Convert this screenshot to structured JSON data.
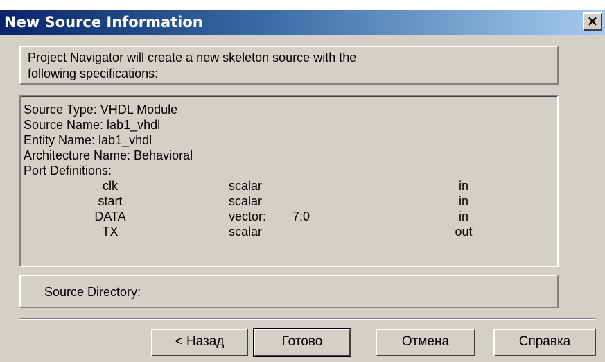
{
  "window": {
    "title": "New Source Information",
    "close_symbol": "×"
  },
  "intro": {
    "line1": "Project Navigator will create a new skeleton source with the",
    "line2": "following specifications:"
  },
  "specs": {
    "source_type": "Source Type:  VHDL Module",
    "source_name": "Source Name:  lab1_vhdl",
    "entity_name": "Entity Name:  lab1_vhdl",
    "architecture_name": "Architecture Name:  Behavioral",
    "port_definitions_label": "Port Definitions:",
    "ports": [
      {
        "name": "clk",
        "type": "scalar",
        "range": "",
        "direction": "in"
      },
      {
        "name": "start",
        "type": "scalar",
        "range": "",
        "direction": "in"
      },
      {
        "name": "DATA",
        "type": "vector:",
        "range": "7:0",
        "direction": "in"
      },
      {
        "name": "TX",
        "type": "scalar",
        "range": "",
        "direction": "out"
      }
    ]
  },
  "source_directory": {
    "label": "Source Directory:"
  },
  "buttons": {
    "back": "< Назад",
    "finish": "Готово",
    "cancel": "Отмена",
    "help": "Справка"
  },
  "icons": {
    "close": "close-icon"
  },
  "colors": {
    "titlebar_start": "#0a246a",
    "titlebar_end": "#a6caf0",
    "dialog_face": "#d4d0c8"
  }
}
